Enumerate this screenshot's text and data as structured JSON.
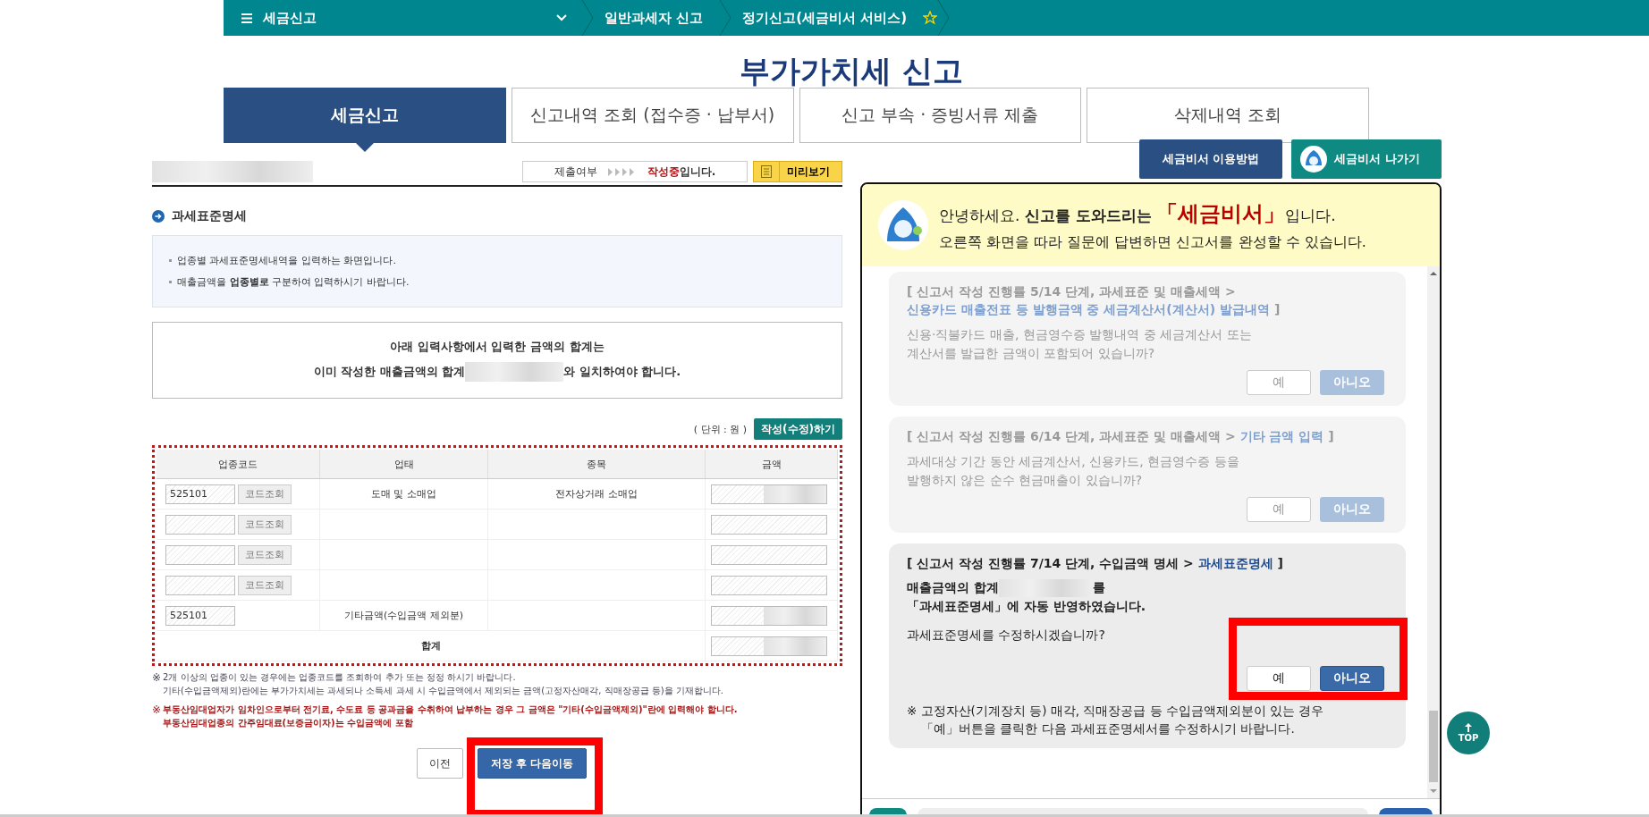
{
  "nav": {
    "menu_label": "세금신고",
    "crumbs": [
      "일반과세자 신고",
      "정기신고(세금비서 서비스)"
    ],
    "favorite": false
  },
  "page_title": "부가가치세 신고",
  "tabs": [
    {
      "label": "세금신고",
      "selected": true
    },
    {
      "label": "신고내역 조회 (접수증 · 납부서)",
      "selected": false
    },
    {
      "label": "신고 부속 · 증빙서류 제출",
      "selected": false
    },
    {
      "label": "삭제내역 조회",
      "selected": false
    }
  ],
  "status": {
    "label": "제출여부",
    "state": "작성중",
    "suffix": "입니다."
  },
  "preview_button": "미리보기",
  "section_title": "과세표준명세",
  "info_lines": [
    "업종별 과세표준명세내역을 입력하는 화면입니다.",
    "매출금액을 **업종별로** 구분하여 입력하시기 바랍니다."
  ],
  "sum_notice": {
    "line1": "아래 입력사항에서  입력한 금액의 합계는",
    "line2_before": "이미 작성한 매출금액의 합계",
    "line2_after": "와 일치하여야 합니다."
  },
  "unit": "( 단위 : 원 )",
  "edit_button": "작성(수정)하기",
  "table": {
    "columns": [
      "업종코드",
      "업태",
      "종목",
      "금액"
    ],
    "rows": [
      {
        "kind": "entry",
        "code": "525101",
        "lookup": "코드조회",
        "business_type": "도매 및 소매업",
        "item": "전자상거래 소매업"
      },
      {
        "kind": "entry",
        "lookup": "코드조회"
      },
      {
        "kind": "entry",
        "lookup": "코드조회"
      },
      {
        "kind": "entry",
        "lookup": "코드조회"
      },
      {
        "kind": "other",
        "code": "525101",
        "business_type": "기타금액(수입금액 제외분)"
      },
      {
        "kind": "total",
        "label": "합계"
      }
    ]
  },
  "notes": [
    {
      "kind": "info",
      "mark": "※",
      "lines": [
        "2개 이상의 업종이 있는 경우에는 업종코드를 조회하여 추가 또는 정정 하시기 바랍니다.",
        "기타(수입금액제외)란에는 부가가치세는 과세되나 소득세 과세 시 수입금액에서 제외되는 금액(고정자산매각, 직매장공급 등)을 기재합니다."
      ]
    },
    {
      "kind": "warning",
      "mark": "※",
      "lines": [
        "부동산임대업자가 임차인으로부터 전기료, 수도료 등 공과금을 수취하여 납부하는 경우  그 금액은 \"기타(수입금액제외)\"란에 입력해야 합니다.",
        "부동산임대업종의 간주임대료(보증금이자)는 수입금액에 포함"
      ]
    }
  ],
  "buttons": [
    {
      "label": "이전",
      "kind": "secondary"
    },
    {
      "label": "저장 후 다음이동",
      "kind": "primary"
    }
  ],
  "assistant_buttons": [
    {
      "label": "세금비서 이용방법",
      "kind": "guide"
    },
    {
      "label": "세금비서 나가기",
      "kind": "exit"
    }
  ],
  "greeting": {
    "intro": "안녕하세요.",
    "bold": "신고를 도와드리는",
    "name": "「세금비서」",
    "suffix": "입니다.",
    "line2": "오른쪽 화면을 따라 질문에 답변하면 신고서를 완성할 수 있습니다."
  },
  "steps": [
    {
      "active": false,
      "header": "[ 신고서 작성 진행률 5/14 단계, 과세표준 및 매출세액 >",
      "link": "신용카드 매출전표 등 발행금액 중 세금계산서(계산서) 발급내역",
      "header_end": "]",
      "question": [
        "신용·직불카드 매출, 현금영수증 발행내역 중 세금계산서 또는",
        "계산서를 발급한 금액이 포함되어 있습니까?"
      ],
      "yes": "예",
      "no": "아니오"
    },
    {
      "active": false,
      "header": "[ 신고서 작성 진행률 6/14 단계, 과세표준 및 매출세액 >",
      "link": "기타 금액 입력",
      "header_end": "]",
      "question": [
        "과세대상 기간 동안 세금계산서, 신용카드, 현금영수증 등을",
        "발행하지 않은 순수 현금매출이 있습니까?"
      ],
      "yes": "예",
      "no": "아니오"
    },
    {
      "active": true,
      "header": "[ 신고서 작성 진행률 7/14 단계, 수입금액 명세 >",
      "link": "과세표준명세",
      "header_end": "]",
      "sum_before": "매출금액의 합계",
      "sum_after": "를",
      "reflected": "「과세표준명세」에 자동 반영하였습니다.",
      "question": [
        "과세표준명세를 수정하시겠습니까?"
      ],
      "yes": "예",
      "no": "아니오",
      "note": [
        "※ 고정자산(기계장치 등) 매각, 직매장공급 등 수입금액제외분이 있는 경우",
        "「예」버튼을 클릭한 다음 과세표준명세서를 수정하시기 바랍니다."
      ]
    }
  ],
  "top_button": "TOP"
}
